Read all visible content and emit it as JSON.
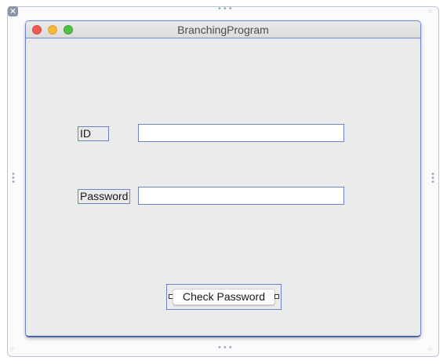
{
  "window": {
    "title": "BranchingProgram"
  },
  "form": {
    "id_label": "ID",
    "id_value": "",
    "password_label": "Password",
    "password_value": "",
    "check_button_label": "Check Password"
  },
  "editor": {
    "close_glyph": "✕",
    "handle_glyph_h": "•••",
    "handle_glyph_v": "• • •",
    "corner_glyph": "⁘"
  },
  "colors": {
    "selection_outline": "#6f82c6",
    "traffic_close": "#ee5b52",
    "traffic_minimize": "#f5b83a",
    "traffic_maximize": "#4fc041"
  }
}
